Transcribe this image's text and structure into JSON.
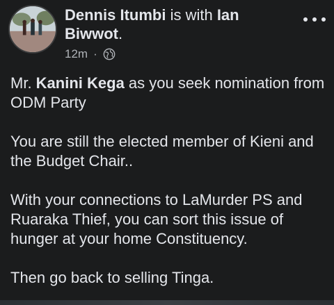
{
  "post": {
    "author": "Dennis Itumbi",
    "with_text": " is with ",
    "tagged": "Ian Biwwot",
    "tagged_suffix": ".",
    "time": "12m",
    "separator": "·",
    "visibility_icon": "globe-icon",
    "more_icon": "more-dots-icon",
    "body": {
      "p1_pre": "Mr. ",
      "p1_bold": "Kanini Kega",
      "p1_post": " as you seek nomination from ODM Party",
      "p2": "You are still the elected member of Kieni and the Budget Chair..",
      "p3": "With your connections to LaMurder PS and Ruaraka Thief, you can sort this issue of hunger at your home Constituency.",
      "p4": "Then go back to selling Tinga."
    }
  }
}
